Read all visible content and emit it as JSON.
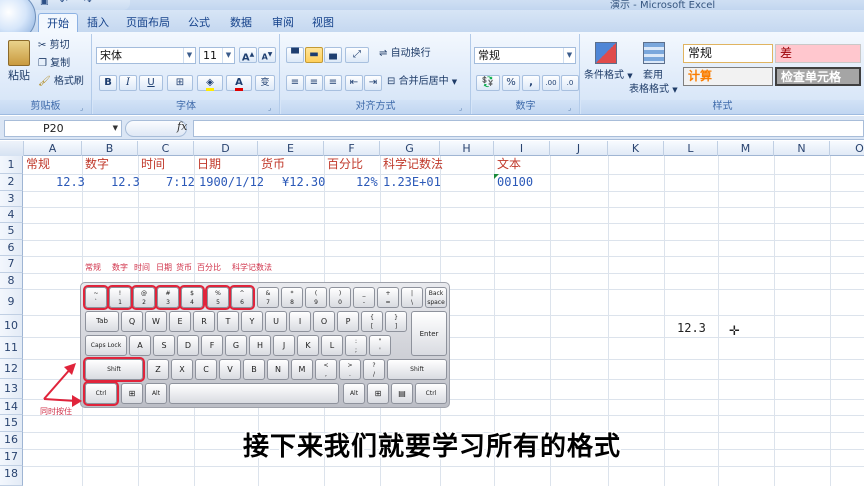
{
  "window": {
    "title": "演示 - Microsoft Excel"
  },
  "qat": {
    "icons": [
      "excel-logo-icon",
      "undo-icon",
      "redo-icon"
    ]
  },
  "tabs": [
    "开始",
    "插入",
    "页面布局",
    "公式",
    "数据",
    "审阅",
    "视图"
  ],
  "ribbon": {
    "clipboard": {
      "label": "剪贴板",
      "paste": "粘贴",
      "cut": "剪切",
      "copy": "复制",
      "painter": "格式刷"
    },
    "font": {
      "label": "字体",
      "name": "宋体",
      "size": "11",
      "bold": "B",
      "italic": "I",
      "underline": "U",
      "grow": "A",
      "shrink": "A",
      "wen": "变"
    },
    "alignment": {
      "label": "对齐方式",
      "wrap": "自动换行",
      "merge": "合并后居中"
    },
    "number": {
      "label": "数字",
      "format": "常规",
      "percent": "%",
      "comma": ",",
      "inc": ".00",
      "dec": ".0"
    },
    "styles": {
      "label": "样式",
      "conditional": "条件格式",
      "table": "套用\n表格格式",
      "table_l1": "套用",
      "table_l2": "表格格式",
      "cell_normal": "常规",
      "cell_bad": "差",
      "cell_calc": "计算",
      "cell_check": "检查单元格"
    }
  },
  "formula_bar": {
    "name_box": "P20",
    "fx": "fx",
    "value": ""
  },
  "grid": {
    "columns": [
      "A",
      "B",
      "C",
      "D",
      "E",
      "F",
      "G",
      "H",
      "I",
      "J",
      "K",
      "L",
      "M",
      "N",
      "O"
    ],
    "rows": [
      "1",
      "2",
      "3",
      "4",
      "5",
      "6",
      "7",
      "8",
      "9",
      "10",
      "11",
      "12",
      "13",
      "14",
      "15",
      "16",
      "17",
      "18"
    ],
    "row1": {
      "A": "常规",
      "B": "数字",
      "C": "时间",
      "D": "日期",
      "E": "货币",
      "F": "百分比",
      "G": "科学记数法",
      "I": "文本"
    },
    "row2": {
      "A": "12.3",
      "B": "12.3",
      "C": "7:12",
      "D": "1900/1/12",
      "E": "¥12.30",
      "F": "12%",
      "G": "1.23E+01",
      "I": "00100"
    },
    "l10": "12.3"
  },
  "overlay": {
    "labels": [
      "常规",
      "数字",
      "时间",
      "日期",
      "货币",
      "百分比",
      "科学记数法"
    ],
    "press_together": "同时按住",
    "keys": {
      "row0": [
        [
          "~",
          "`"
        ],
        [
          "!",
          "1"
        ],
        [
          "@",
          "2"
        ],
        [
          "#",
          "3"
        ],
        [
          "$",
          "4"
        ],
        [
          "%",
          "5"
        ],
        [
          "^",
          "6"
        ],
        [
          "&",
          "7"
        ],
        [
          "*",
          "8"
        ],
        [
          "(",
          "9"
        ],
        [
          ")",
          "0"
        ],
        [
          "_",
          "-"
        ],
        [
          "+",
          "="
        ],
        [
          "|",
          "\\"
        ],
        [
          "Back",
          "space"
        ]
      ],
      "tab": "Tab",
      "row1": [
        "Q",
        "W",
        "E",
        "R",
        "T",
        "Y",
        "U",
        "I",
        "O",
        "P"
      ],
      "br1": [
        "{",
        "["
      ],
      "br2": [
        "}",
        "]"
      ],
      "caps": "Caps Lock",
      "row2": [
        "A",
        "S",
        "D",
        "F",
        "G",
        "H",
        "J",
        "K",
        "L"
      ],
      "semi": [
        ":",
        ";"
      ],
      "quote": [
        "\"",
        "'"
      ],
      "enter": "Enter",
      "shift": "Shift",
      "row3": [
        "Z",
        "X",
        "C",
        "V",
        "B",
        "N",
        "M"
      ],
      "lt": [
        "<",
        ","
      ],
      "gt": [
        ">",
        "."
      ],
      "q": [
        "?",
        "/"
      ],
      "rshift": "Shift",
      "ctrl": "Ctrl",
      "alt": "Alt",
      "ralt": "Alt",
      "rctrl": "Ctrl"
    }
  },
  "subtitle": "接下来我们就要学习所有的格式"
}
